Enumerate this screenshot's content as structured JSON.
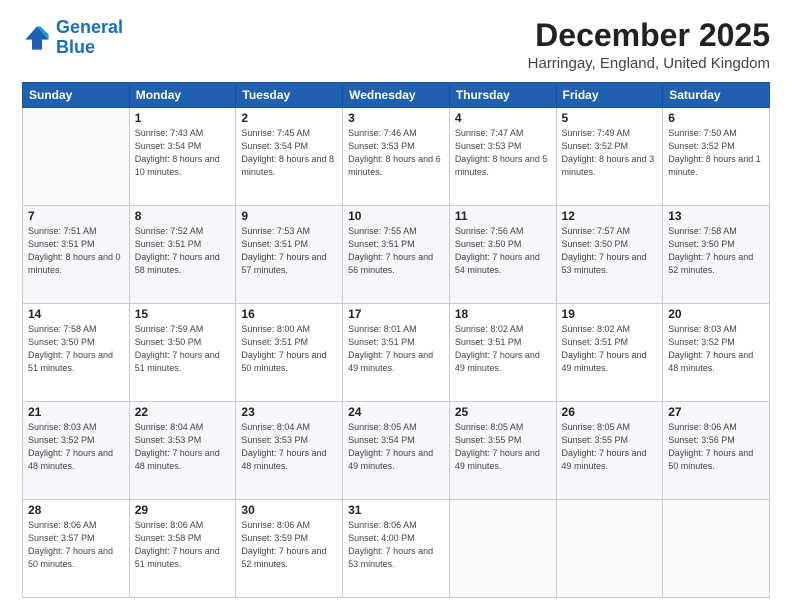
{
  "logo": {
    "line1": "General",
    "line2": "Blue"
  },
  "header": {
    "title": "December 2025",
    "subtitle": "Harringay, England, United Kingdom"
  },
  "days_of_week": [
    "Sunday",
    "Monday",
    "Tuesday",
    "Wednesday",
    "Thursday",
    "Friday",
    "Saturday"
  ],
  "weeks": [
    [
      {
        "day": "",
        "info": ""
      },
      {
        "day": "1",
        "info": "Sunrise: 7:43 AM\nSunset: 3:54 PM\nDaylight: 8 hours\nand 10 minutes."
      },
      {
        "day": "2",
        "info": "Sunrise: 7:45 AM\nSunset: 3:54 PM\nDaylight: 8 hours\nand 8 minutes."
      },
      {
        "day": "3",
        "info": "Sunrise: 7:46 AM\nSunset: 3:53 PM\nDaylight: 8 hours\nand 6 minutes."
      },
      {
        "day": "4",
        "info": "Sunrise: 7:47 AM\nSunset: 3:53 PM\nDaylight: 8 hours\nand 5 minutes."
      },
      {
        "day": "5",
        "info": "Sunrise: 7:49 AM\nSunset: 3:52 PM\nDaylight: 8 hours\nand 3 minutes."
      },
      {
        "day": "6",
        "info": "Sunrise: 7:50 AM\nSunset: 3:52 PM\nDaylight: 8 hours\nand 1 minute."
      }
    ],
    [
      {
        "day": "7",
        "info": "Sunrise: 7:51 AM\nSunset: 3:51 PM\nDaylight: 8 hours\nand 0 minutes."
      },
      {
        "day": "8",
        "info": "Sunrise: 7:52 AM\nSunset: 3:51 PM\nDaylight: 7 hours\nand 58 minutes."
      },
      {
        "day": "9",
        "info": "Sunrise: 7:53 AM\nSunset: 3:51 PM\nDaylight: 7 hours\nand 57 minutes."
      },
      {
        "day": "10",
        "info": "Sunrise: 7:55 AM\nSunset: 3:51 PM\nDaylight: 7 hours\nand 56 minutes."
      },
      {
        "day": "11",
        "info": "Sunrise: 7:56 AM\nSunset: 3:50 PM\nDaylight: 7 hours\nand 54 minutes."
      },
      {
        "day": "12",
        "info": "Sunrise: 7:57 AM\nSunset: 3:50 PM\nDaylight: 7 hours\nand 53 minutes."
      },
      {
        "day": "13",
        "info": "Sunrise: 7:58 AM\nSunset: 3:50 PM\nDaylight: 7 hours\nand 52 minutes."
      }
    ],
    [
      {
        "day": "14",
        "info": "Sunrise: 7:58 AM\nSunset: 3:50 PM\nDaylight: 7 hours\nand 51 minutes."
      },
      {
        "day": "15",
        "info": "Sunrise: 7:59 AM\nSunset: 3:50 PM\nDaylight: 7 hours\nand 51 minutes."
      },
      {
        "day": "16",
        "info": "Sunrise: 8:00 AM\nSunset: 3:51 PM\nDaylight: 7 hours\nand 50 minutes."
      },
      {
        "day": "17",
        "info": "Sunrise: 8:01 AM\nSunset: 3:51 PM\nDaylight: 7 hours\nand 49 minutes."
      },
      {
        "day": "18",
        "info": "Sunrise: 8:02 AM\nSunset: 3:51 PM\nDaylight: 7 hours\nand 49 minutes."
      },
      {
        "day": "19",
        "info": "Sunrise: 8:02 AM\nSunset: 3:51 PM\nDaylight: 7 hours\nand 49 minutes."
      },
      {
        "day": "20",
        "info": "Sunrise: 8:03 AM\nSunset: 3:52 PM\nDaylight: 7 hours\nand 48 minutes."
      }
    ],
    [
      {
        "day": "21",
        "info": "Sunrise: 8:03 AM\nSunset: 3:52 PM\nDaylight: 7 hours\nand 48 minutes."
      },
      {
        "day": "22",
        "info": "Sunrise: 8:04 AM\nSunset: 3:53 PM\nDaylight: 7 hours\nand 48 minutes."
      },
      {
        "day": "23",
        "info": "Sunrise: 8:04 AM\nSunset: 3:53 PM\nDaylight: 7 hours\nand 48 minutes."
      },
      {
        "day": "24",
        "info": "Sunrise: 8:05 AM\nSunset: 3:54 PM\nDaylight: 7 hours\nand 49 minutes."
      },
      {
        "day": "25",
        "info": "Sunrise: 8:05 AM\nSunset: 3:55 PM\nDaylight: 7 hours\nand 49 minutes."
      },
      {
        "day": "26",
        "info": "Sunrise: 8:05 AM\nSunset: 3:55 PM\nDaylight: 7 hours\nand 49 minutes."
      },
      {
        "day": "27",
        "info": "Sunrise: 8:06 AM\nSunset: 3:56 PM\nDaylight: 7 hours\nand 50 minutes."
      }
    ],
    [
      {
        "day": "28",
        "info": "Sunrise: 8:06 AM\nSunset: 3:57 PM\nDaylight: 7 hours\nand 50 minutes."
      },
      {
        "day": "29",
        "info": "Sunrise: 8:06 AM\nSunset: 3:58 PM\nDaylight: 7 hours\nand 51 minutes."
      },
      {
        "day": "30",
        "info": "Sunrise: 8:06 AM\nSunset: 3:59 PM\nDaylight: 7 hours\nand 52 minutes."
      },
      {
        "day": "31",
        "info": "Sunrise: 8:06 AM\nSunset: 4:00 PM\nDaylight: 7 hours\nand 53 minutes."
      },
      {
        "day": "",
        "info": ""
      },
      {
        "day": "",
        "info": ""
      },
      {
        "day": "",
        "info": ""
      }
    ]
  ]
}
